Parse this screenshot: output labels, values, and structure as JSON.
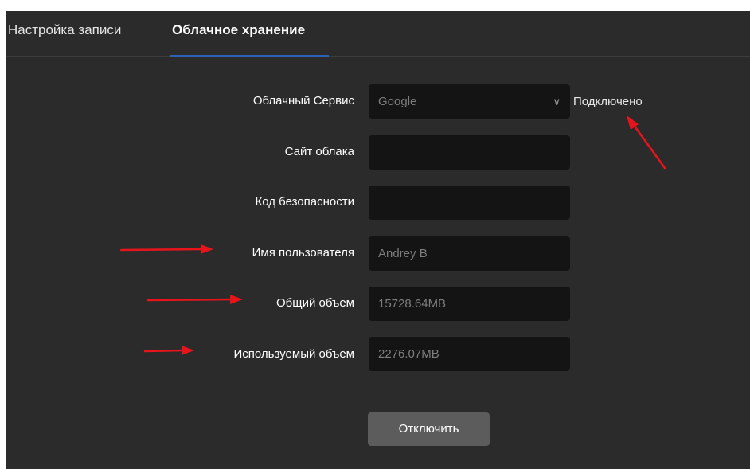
{
  "tabs": [
    {
      "label": "Настройка записи"
    },
    {
      "label": "Облачное хранение"
    }
  ],
  "form": {
    "cloud_service": {
      "label": "Облачный Сервис",
      "value": "Google",
      "status": "Подключено"
    },
    "cloud_site": {
      "label": "Сайт облака",
      "value": ""
    },
    "security_code": {
      "label": "Код безопасности",
      "value": ""
    },
    "username": {
      "label": "Имя пользователя",
      "value": "Andrey B"
    },
    "total_volume": {
      "label": "Общий объем",
      "value": "15728.64MB"
    },
    "used_volume": {
      "label": "Используемый объем",
      "value": "2276.07MB"
    }
  },
  "actions": {
    "disconnect_label": "Отключить"
  },
  "colors": {
    "background": "#2b2b2b",
    "field_background": "#141414",
    "active_tab_underline": "#2f5fb9",
    "button_background": "#5c5c5c",
    "annotation_arrow": "#e8141b"
  }
}
